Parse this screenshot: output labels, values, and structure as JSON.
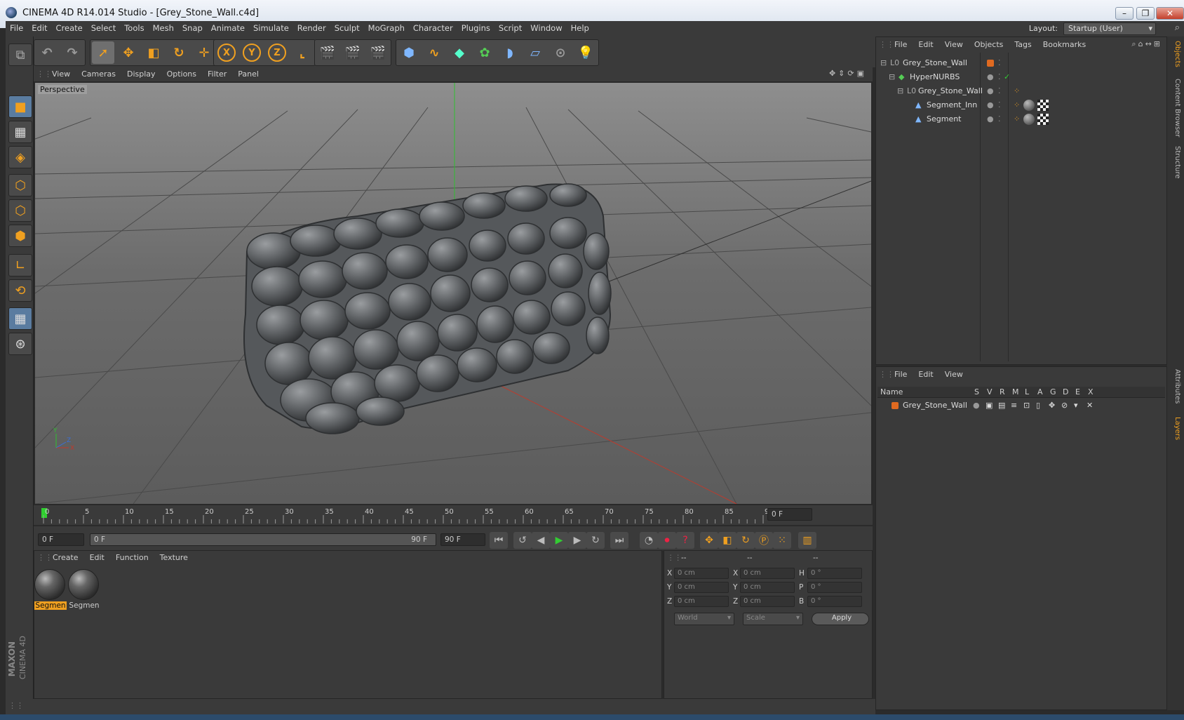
{
  "window": {
    "title": "CINEMA 4D R14.014 Studio - [Grey_Stone_Wall.c4d]"
  },
  "menu": [
    "File",
    "Edit",
    "Create",
    "Select",
    "Tools",
    "Mesh",
    "Snap",
    "Animate",
    "Simulate",
    "Render",
    "Sculpt",
    "MoGraph",
    "Character",
    "Plugins",
    "Script",
    "Window",
    "Help"
  ],
  "layout": {
    "label": "Layout:",
    "value": "Startup (User)"
  },
  "viewport": {
    "menu": [
      "View",
      "Cameras",
      "Display",
      "Options",
      "Filter",
      "Panel"
    ],
    "label": "Perspective"
  },
  "timeline": {
    "ticks": [
      "0",
      "5",
      "10",
      "15",
      "20",
      "25",
      "30",
      "35",
      "40",
      "45",
      "50",
      "55",
      "60",
      "65",
      "70",
      "75",
      "80",
      "85",
      "90"
    ],
    "current_frame": "0 F",
    "start_field": "0 F",
    "range_start": "0 F",
    "range_end": "90 F",
    "end_field": "90 F"
  },
  "materials": {
    "menu": [
      "Create",
      "Edit",
      "Function",
      "Texture"
    ],
    "items": [
      {
        "label": "Segmen",
        "selected": true
      },
      {
        "label": "Segmen",
        "selected": false
      }
    ]
  },
  "coords": {
    "headers": [
      "--",
      "--",
      "--"
    ],
    "rows": [
      {
        "a": "X",
        "av": "0 cm",
        "b": "X",
        "bv": "0 cm",
        "c": "H",
        "cv": "0 °"
      },
      {
        "a": "Y",
        "av": "0 cm",
        "b": "Y",
        "bv": "0 cm",
        "c": "P",
        "cv": "0 °"
      },
      {
        "a": "Z",
        "av": "0 cm",
        "b": "Z",
        "bv": "0 cm",
        "c": "B",
        "cv": "0 °"
      }
    ],
    "mode1": "World",
    "mode2": "Scale",
    "apply": "Apply"
  },
  "objects": {
    "menu": [
      "File",
      "Edit",
      "View",
      "Objects",
      "Tags",
      "Bookmarks"
    ],
    "rows": [
      {
        "name": "Grey_Stone_Wall",
        "indent": 0
      },
      {
        "name": "HyperNURBS",
        "indent": 1
      },
      {
        "name": "Grey_Stone_Wall",
        "indent": 2
      },
      {
        "name": "Segment_Inn",
        "indent": 3
      },
      {
        "name": "Segment",
        "indent": 3
      }
    ]
  },
  "layers": {
    "menu": [
      "File",
      "Edit",
      "View"
    ],
    "columns": [
      "Name",
      "S",
      "V",
      "R",
      "M",
      "L",
      "A",
      "G",
      "D",
      "E",
      "X"
    ],
    "rows": [
      {
        "name": "Grey_Stone_Wall"
      }
    ]
  },
  "side_tabs": [
    "Objects",
    "Content Browser",
    "Structure",
    "Attributes",
    "Layers"
  ],
  "brand": {
    "line1": "MAXON",
    "line2": "CINEMA 4D"
  },
  "colors": {
    "accent": "#f0a020",
    "panel": "#3a3a3a",
    "layer_orange": "#e06a20"
  }
}
